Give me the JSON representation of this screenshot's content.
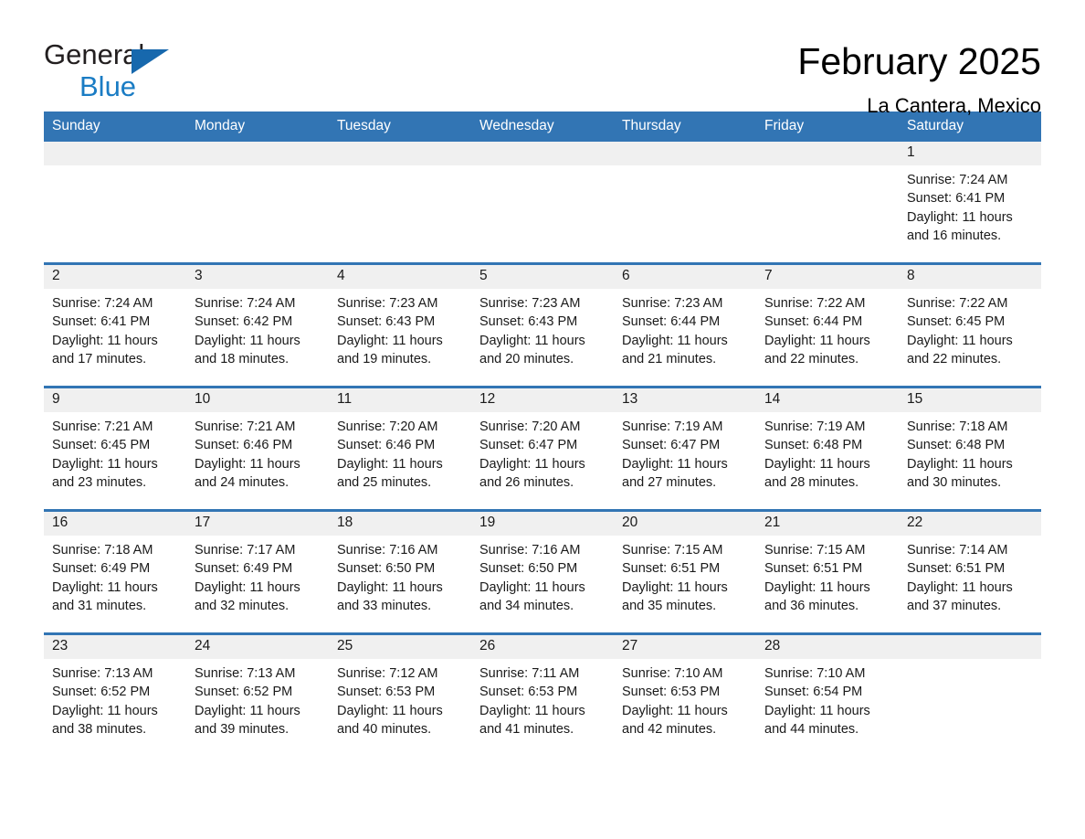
{
  "brand": {
    "name_part1": "General",
    "name_part2": "Blue",
    "triangle_color": "#1768ad",
    "blue_color": "#1a7cc4"
  },
  "header": {
    "title": "February 2025",
    "subtitle": "La Cantera, Mexico"
  },
  "theme": {
    "header_blue": "#3275b4",
    "daynum_band": "#f0f0f0",
    "text": "#1a1a1a"
  },
  "calendar": {
    "weekday_headers": [
      "Sunday",
      "Monday",
      "Tuesday",
      "Wednesday",
      "Thursday",
      "Friday",
      "Saturday"
    ],
    "weeks": [
      [
        {
          "day": "",
          "sunrise": "",
          "sunset": "",
          "daylight": ""
        },
        {
          "day": "",
          "sunrise": "",
          "sunset": "",
          "daylight": ""
        },
        {
          "day": "",
          "sunrise": "",
          "sunset": "",
          "daylight": ""
        },
        {
          "day": "",
          "sunrise": "",
          "sunset": "",
          "daylight": ""
        },
        {
          "day": "",
          "sunrise": "",
          "sunset": "",
          "daylight": ""
        },
        {
          "day": "",
          "sunrise": "",
          "sunset": "",
          "daylight": ""
        },
        {
          "day": "1",
          "sunrise": "Sunrise: 7:24 AM",
          "sunset": "Sunset: 6:41 PM",
          "daylight": "Daylight: 11 hours and 16 minutes."
        }
      ],
      [
        {
          "day": "2",
          "sunrise": "Sunrise: 7:24 AM",
          "sunset": "Sunset: 6:41 PM",
          "daylight": "Daylight: 11 hours and 17 minutes."
        },
        {
          "day": "3",
          "sunrise": "Sunrise: 7:24 AM",
          "sunset": "Sunset: 6:42 PM",
          "daylight": "Daylight: 11 hours and 18 minutes."
        },
        {
          "day": "4",
          "sunrise": "Sunrise: 7:23 AM",
          "sunset": "Sunset: 6:43 PM",
          "daylight": "Daylight: 11 hours and 19 minutes."
        },
        {
          "day": "5",
          "sunrise": "Sunrise: 7:23 AM",
          "sunset": "Sunset: 6:43 PM",
          "daylight": "Daylight: 11 hours and 20 minutes."
        },
        {
          "day": "6",
          "sunrise": "Sunrise: 7:23 AM",
          "sunset": "Sunset: 6:44 PM",
          "daylight": "Daylight: 11 hours and 21 minutes."
        },
        {
          "day": "7",
          "sunrise": "Sunrise: 7:22 AM",
          "sunset": "Sunset: 6:44 PM",
          "daylight": "Daylight: 11 hours and 22 minutes."
        },
        {
          "day": "8",
          "sunrise": "Sunrise: 7:22 AM",
          "sunset": "Sunset: 6:45 PM",
          "daylight": "Daylight: 11 hours and 22 minutes."
        }
      ],
      [
        {
          "day": "9",
          "sunrise": "Sunrise: 7:21 AM",
          "sunset": "Sunset: 6:45 PM",
          "daylight": "Daylight: 11 hours and 23 minutes."
        },
        {
          "day": "10",
          "sunrise": "Sunrise: 7:21 AM",
          "sunset": "Sunset: 6:46 PM",
          "daylight": "Daylight: 11 hours and 24 minutes."
        },
        {
          "day": "11",
          "sunrise": "Sunrise: 7:20 AM",
          "sunset": "Sunset: 6:46 PM",
          "daylight": "Daylight: 11 hours and 25 minutes."
        },
        {
          "day": "12",
          "sunrise": "Sunrise: 7:20 AM",
          "sunset": "Sunset: 6:47 PM",
          "daylight": "Daylight: 11 hours and 26 minutes."
        },
        {
          "day": "13",
          "sunrise": "Sunrise: 7:19 AM",
          "sunset": "Sunset: 6:47 PM",
          "daylight": "Daylight: 11 hours and 27 minutes."
        },
        {
          "day": "14",
          "sunrise": "Sunrise: 7:19 AM",
          "sunset": "Sunset: 6:48 PM",
          "daylight": "Daylight: 11 hours and 28 minutes."
        },
        {
          "day": "15",
          "sunrise": "Sunrise: 7:18 AM",
          "sunset": "Sunset: 6:48 PM",
          "daylight": "Daylight: 11 hours and 30 minutes."
        }
      ],
      [
        {
          "day": "16",
          "sunrise": "Sunrise: 7:18 AM",
          "sunset": "Sunset: 6:49 PM",
          "daylight": "Daylight: 11 hours and 31 minutes."
        },
        {
          "day": "17",
          "sunrise": "Sunrise: 7:17 AM",
          "sunset": "Sunset: 6:49 PM",
          "daylight": "Daylight: 11 hours and 32 minutes."
        },
        {
          "day": "18",
          "sunrise": "Sunrise: 7:16 AM",
          "sunset": "Sunset: 6:50 PM",
          "daylight": "Daylight: 11 hours and 33 minutes."
        },
        {
          "day": "19",
          "sunrise": "Sunrise: 7:16 AM",
          "sunset": "Sunset: 6:50 PM",
          "daylight": "Daylight: 11 hours and 34 minutes."
        },
        {
          "day": "20",
          "sunrise": "Sunrise: 7:15 AM",
          "sunset": "Sunset: 6:51 PM",
          "daylight": "Daylight: 11 hours and 35 minutes."
        },
        {
          "day": "21",
          "sunrise": "Sunrise: 7:15 AM",
          "sunset": "Sunset: 6:51 PM",
          "daylight": "Daylight: 11 hours and 36 minutes."
        },
        {
          "day": "22",
          "sunrise": "Sunrise: 7:14 AM",
          "sunset": "Sunset: 6:51 PM",
          "daylight": "Daylight: 11 hours and 37 minutes."
        }
      ],
      [
        {
          "day": "23",
          "sunrise": "Sunrise: 7:13 AM",
          "sunset": "Sunset: 6:52 PM",
          "daylight": "Daylight: 11 hours and 38 minutes."
        },
        {
          "day": "24",
          "sunrise": "Sunrise: 7:13 AM",
          "sunset": "Sunset: 6:52 PM",
          "daylight": "Daylight: 11 hours and 39 minutes."
        },
        {
          "day": "25",
          "sunrise": "Sunrise: 7:12 AM",
          "sunset": "Sunset: 6:53 PM",
          "daylight": "Daylight: 11 hours and 40 minutes."
        },
        {
          "day": "26",
          "sunrise": "Sunrise: 7:11 AM",
          "sunset": "Sunset: 6:53 PM",
          "daylight": "Daylight: 11 hours and 41 minutes."
        },
        {
          "day": "27",
          "sunrise": "Sunrise: 7:10 AM",
          "sunset": "Sunset: 6:53 PM",
          "daylight": "Daylight: 11 hours and 42 minutes."
        },
        {
          "day": "28",
          "sunrise": "Sunrise: 7:10 AM",
          "sunset": "Sunset: 6:54 PM",
          "daylight": "Daylight: 11 hours and 44 minutes."
        },
        {
          "day": "",
          "sunrise": "",
          "sunset": "",
          "daylight": ""
        }
      ]
    ]
  }
}
